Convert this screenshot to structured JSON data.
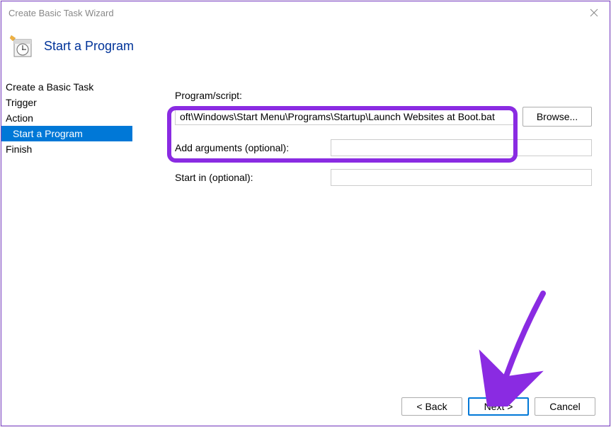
{
  "window": {
    "title": "Create Basic Task Wizard"
  },
  "header": {
    "title": "Start a Program"
  },
  "sidebar": {
    "items": [
      {
        "label": "Create a Basic Task",
        "selected": false,
        "indented": false
      },
      {
        "label": "Trigger",
        "selected": false,
        "indented": false
      },
      {
        "label": "Action",
        "selected": false,
        "indented": false
      },
      {
        "label": "Start a Program",
        "selected": true,
        "indented": true
      },
      {
        "label": "Finish",
        "selected": false,
        "indented": false
      }
    ]
  },
  "main": {
    "program_label": "Program/script:",
    "program_value": "oft\\Windows\\Start Menu\\Programs\\Startup\\Launch Websites at Boot.bat",
    "browse_label": "Browse...",
    "args_label": "Add arguments (optional):",
    "args_value": "",
    "startin_label": "Start in (optional):",
    "startin_value": ""
  },
  "buttons": {
    "back": "< Back",
    "next": "Next >",
    "cancel": "Cancel"
  },
  "annotations": {
    "highlight_color": "#8a2be2"
  }
}
